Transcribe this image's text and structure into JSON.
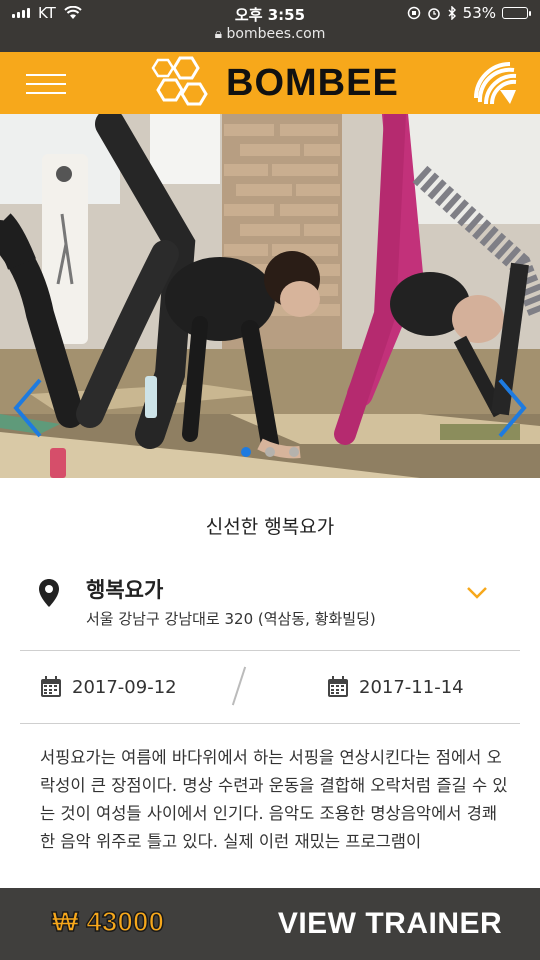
{
  "status_bar": {
    "carrier": "KT",
    "time": "오후 3:55",
    "url": "bombees.com",
    "battery": "53%",
    "battery_level": 0.53
  },
  "header": {
    "brand": "BOMBEE",
    "colors": {
      "accent": "#f7a81b",
      "dark": "#403f3d"
    },
    "icons": {
      "menu": "hamburger-icon",
      "share": "share-icon",
      "logo": "honeycomb-logo"
    }
  },
  "carousel": {
    "slide_count": 3,
    "active_index": 0,
    "prev_icon": "chevron-left-icon",
    "next_icon": "chevron-right-icon"
  },
  "class": {
    "title": "신선한 행복요가",
    "location_name": "행복요가",
    "address": "서울 강남구 강남대로 320 (역삼동, 황화빌딩)",
    "start_date": "2017-09-12",
    "end_date": "2017-11-14",
    "description": "서핑요가는 여름에 바다위에서 하는 서핑을 연상시킨다는 점에서 오락성이 큰 장점이다. 명상 수련과 운동을 결합해 오락처럼 즐길 수 있는 것이 여성들 사이에서 인기다. 음악도 조용한 명상음악에서 경쾌한 음악 위주로 틀고 있다. 실제 이런 재밌는 프로그램이"
  },
  "footer": {
    "price": "₩ 43000",
    "cta": "VIEW TRAINER"
  }
}
